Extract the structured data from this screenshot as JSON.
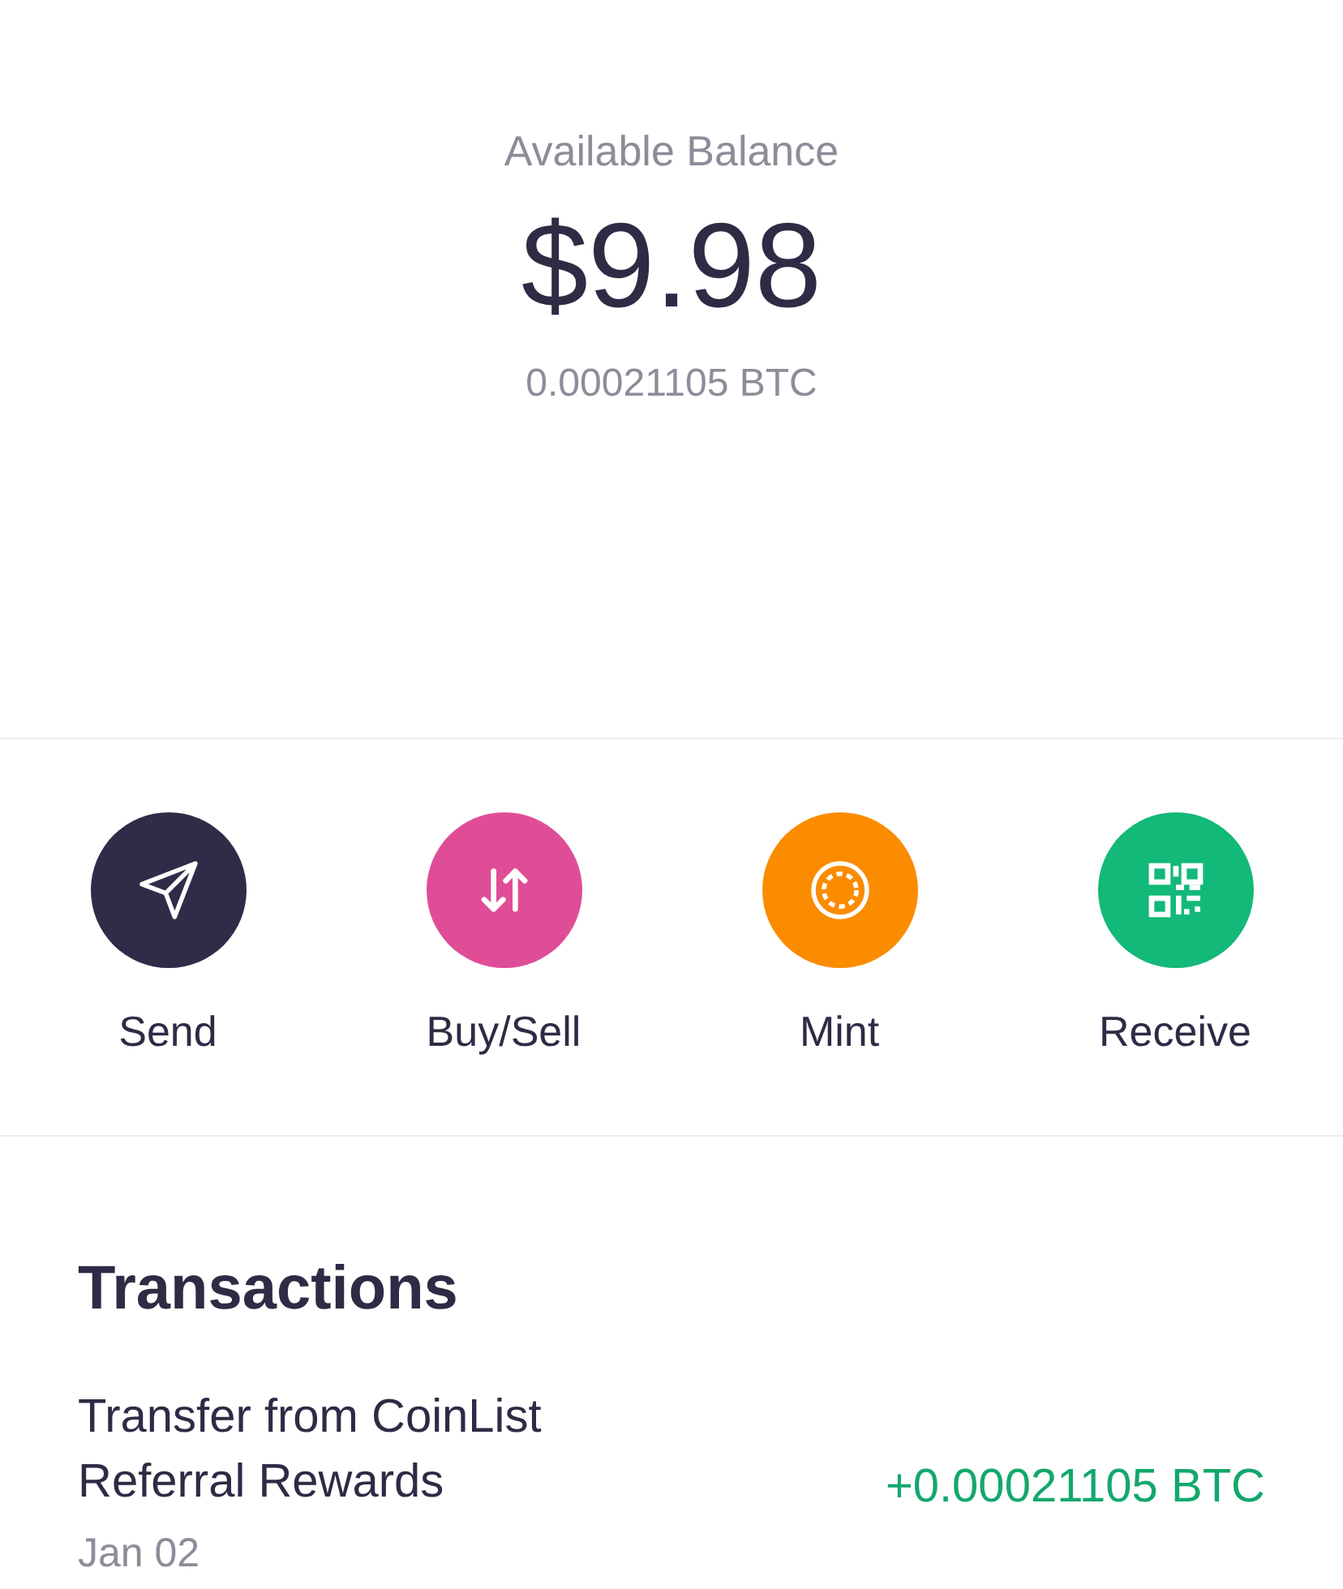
{
  "balance": {
    "label": "Available Balance",
    "amount": "$9.98",
    "crypto": "0.00021105 BTC"
  },
  "actions": [
    {
      "kind": "send",
      "label": "Send",
      "color": "#302c48"
    },
    {
      "kind": "buysell",
      "label": "Buy/Sell",
      "color": "#e04d97"
    },
    {
      "kind": "mint",
      "label": "Mint",
      "color": "#fb8c00"
    },
    {
      "kind": "receive",
      "label": "Receive",
      "color": "#12b978"
    }
  ],
  "transactions": {
    "title": "Transactions",
    "rows": [
      {
        "description": "Transfer from CoinList Referral Rewards",
        "amount": "+0.00021105 BTC",
        "date": "Jan 02"
      }
    ]
  }
}
